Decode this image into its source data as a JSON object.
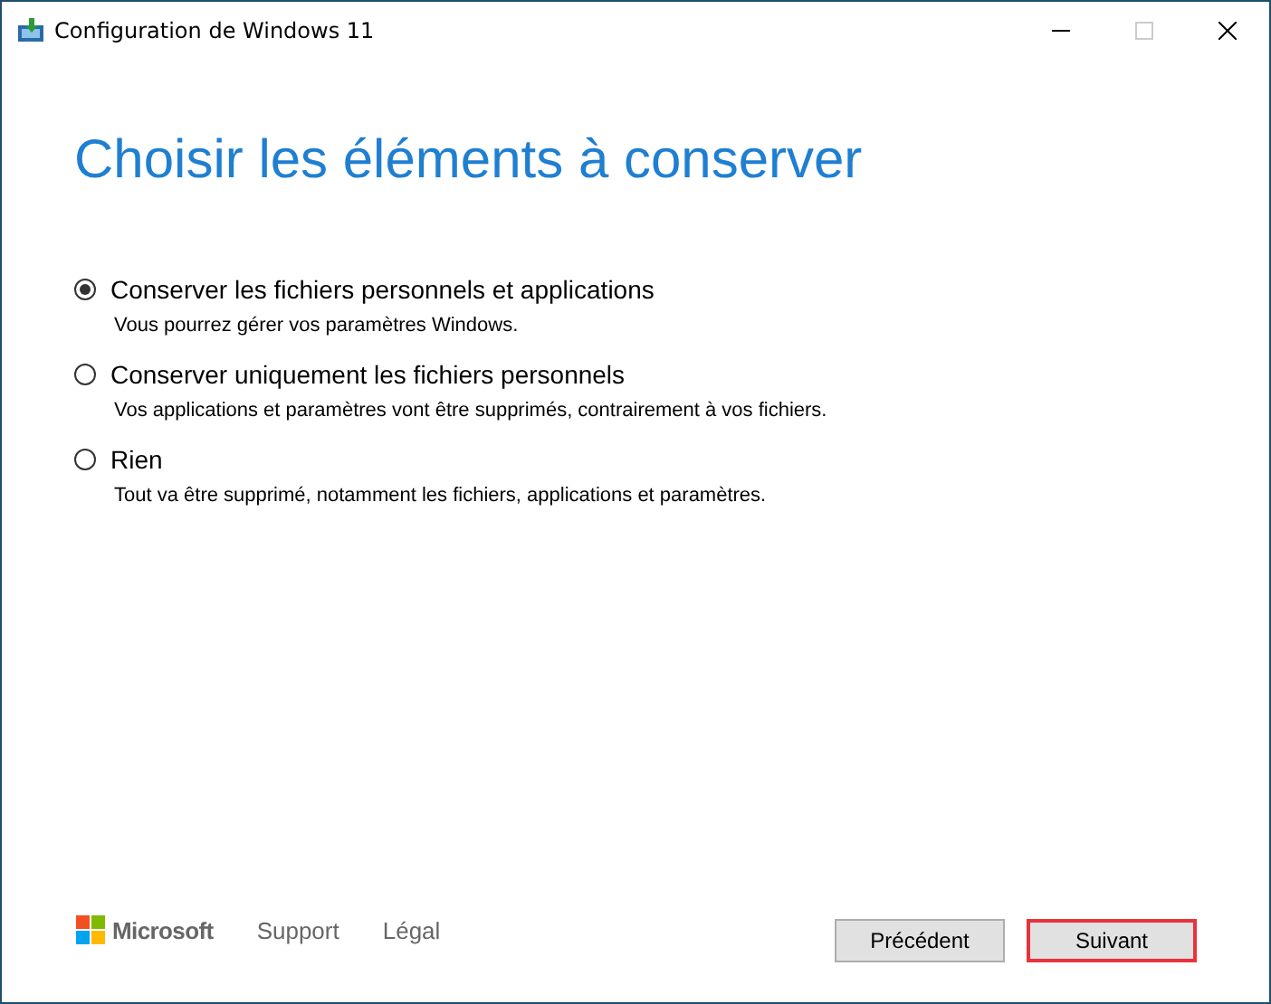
{
  "window": {
    "title": "Configuration de Windows 11"
  },
  "heading": "Choisir les éléments à conserver",
  "options": [
    {
      "label": "Conserver les fichiers personnels et applications",
      "description": "Vous pourrez gérer vos paramètres Windows.",
      "selected": true
    },
    {
      "label": "Conserver uniquement les fichiers personnels",
      "description": "Vos applications et paramètres vont être supprimés, contrairement à vos fichiers.",
      "selected": false
    },
    {
      "label": "Rien",
      "description": "Tout va être supprimé, notamment les fichiers, applications et paramètres.",
      "selected": false
    }
  ],
  "footer": {
    "brand": "Microsoft",
    "links": [
      "Support",
      "Légal"
    ]
  },
  "buttons": [
    {
      "label": "Précédent",
      "highlighted": false
    },
    {
      "label": "Suivant",
      "highlighted": true
    }
  ]
}
